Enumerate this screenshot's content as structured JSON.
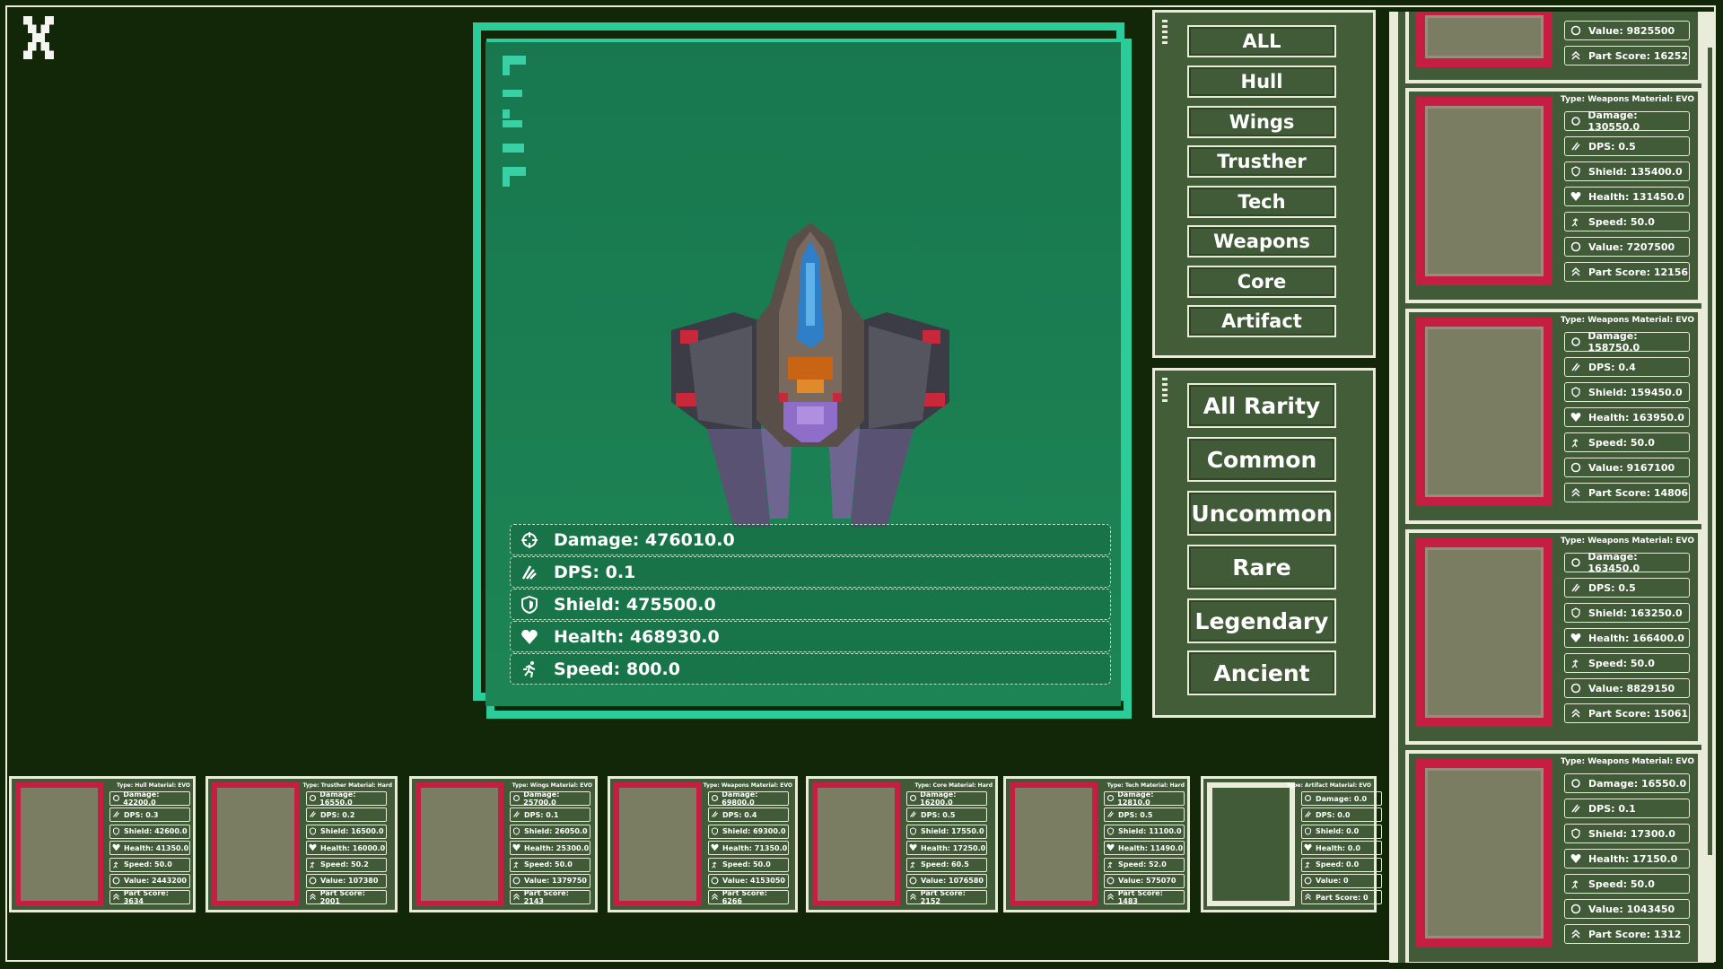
{
  "close_icon": "close-icon",
  "preview": {
    "stats": [
      {
        "icon": "target-icon",
        "label": "Damage: 476010.0"
      },
      {
        "icon": "slash-icon",
        "label": "DPS: 0.1"
      },
      {
        "icon": "shield-icon",
        "label": "Shield: 475500.0"
      },
      {
        "icon": "heart-icon",
        "label": "Health: 468930.0"
      },
      {
        "icon": "run-icon",
        "label": "Speed: 800.0"
      }
    ]
  },
  "type_filters": [
    "ALL",
    "Hull",
    "Wings",
    "Trusther",
    "Tech",
    "Weapons",
    "Core",
    "Artifact"
  ],
  "rarity_filters": [
    "All Rarity",
    "Common",
    "Uncommon",
    "Rare",
    "Legendary",
    "Ancient"
  ],
  "parts_list": [
    {
      "type": "",
      "stats": [
        "Value: 9825500",
        "Part Score: 16252"
      ]
    },
    {
      "type": "Type: Weapons Material: EVO",
      "stats": [
        "Damage: 130550.0",
        "DPS: 0.5",
        "Shield: 135400.0",
        "Health: 131450.0",
        "Speed: 50.0",
        "Value: 7207500",
        "Part Score: 12156"
      ]
    },
    {
      "type": "Type: Weapons Material: EVO",
      "stats": [
        "Damage: 158750.0",
        "DPS: 0.4",
        "Shield: 159450.0",
        "Health: 163950.0",
        "Speed: 50.0",
        "Value: 9167100",
        "Part Score: 14806"
      ]
    },
    {
      "type": "Type: Weapons Material: EVO",
      "stats": [
        "Damage: 163450.0",
        "DPS: 0.5",
        "Shield: 163250.0",
        "Health: 166400.0",
        "Speed: 50.0",
        "Value: 8829150",
        "Part Score: 15061"
      ]
    },
    {
      "type": "Type: Weapons Material: EVO",
      "stats": [
        "Damage: 16550.0",
        "DPS: 0.1",
        "Shield: 17300.0",
        "Health: 17150.0",
        "Speed: 50.0",
        "Value: 1043450",
        "Part Score: 1312"
      ]
    }
  ],
  "equipped": [
    {
      "type": "Type: Hull Material: EVO",
      "stats": [
        "Damage: 42200.0",
        "DPS: 0.3",
        "Shield: 42600.0",
        "Health: 41350.0",
        "Speed: 50.0",
        "Value: 2443200",
        "Part Score: 3634"
      ]
    },
    {
      "type": "Type: Trusther Material: Hard",
      "stats": [
        "Damage: 16550.0",
        "DPS: 0.2",
        "Shield: 16500.0",
        "Health: 16000.0",
        "Speed: 50.2",
        "Value: 107380",
        "Part Score: 2001"
      ]
    },
    {
      "type": "Type: Wings Material: EVO",
      "stats": [
        "Damage: 25700.0",
        "DPS: 0.1",
        "Shield: 26050.0",
        "Health: 25300.0",
        "Speed: 50.0",
        "Value: 1379750",
        "Part Score: 2143"
      ]
    },
    {
      "type": "Type: Weapons Material: EVO",
      "stats": [
        "Damage: 69800.0",
        "DPS: 0.4",
        "Shield: 69300.0",
        "Health: 71350.0",
        "Speed: 50.0",
        "Value: 4153050",
        "Part Score: 6266"
      ]
    },
    {
      "type": "Type: Core Material: Hard",
      "stats": [
        "Damage: 16200.0",
        "DPS: 0.5",
        "Shield: 17550.0",
        "Health: 17250.0",
        "Speed: 60.5",
        "Value: 1076580",
        "Part Score: 2152"
      ]
    },
    {
      "type": "Type: Tech Material: Hard",
      "stats": [
        "Damage: 12810.0",
        "DPS: 0.5",
        "Shield: 11100.0",
        "Health: 11490.0",
        "Speed: 52.0",
        "Value: 575070",
        "Part Score: 1483"
      ]
    },
    {
      "type": "Type: Artifact Material: EVO",
      "stats": [
        "Damage: 0.0",
        "DPS: 0.0",
        "Shield: 0.0",
        "Health: 0.0",
        "Speed: 0.0",
        "Value: 0",
        "Part Score: 0"
      ]
    }
  ]
}
